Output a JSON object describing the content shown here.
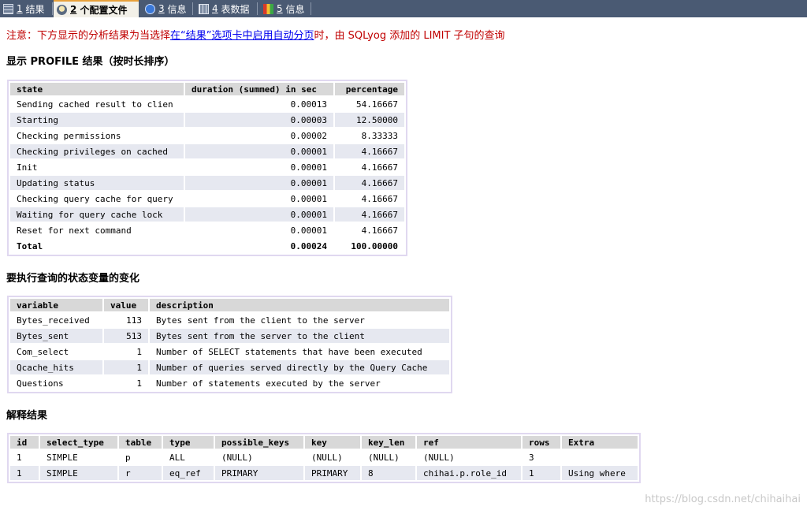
{
  "tabs": [
    {
      "num": "1",
      "label": "结果",
      "icon": "grid-icon"
    },
    {
      "num": "2",
      "label": "个配置文件",
      "icon": "profile-icon"
    },
    {
      "num": "3",
      "label": "信息",
      "icon": "info-icon"
    },
    {
      "num": "4",
      "label": "表数据",
      "icon": "table-icon"
    },
    {
      "num": "5",
      "label": "信息",
      "icon": "history-icon"
    }
  ],
  "notice": {
    "prefix": "注意：下方显示的分析结果为当选择",
    "link": "在“结果”选项卡中启用自动分页",
    "suffix": "时，由 SQLyog 添加的 LIMIT 子句的查询"
  },
  "profile": {
    "heading": "显示 PROFILE 结果（按时长排序）",
    "headers": [
      "state",
      "duration (summed) in sec",
      "percentage"
    ],
    "rows": [
      [
        "Sending cached result to clien",
        "0.00013",
        "54.16667"
      ],
      [
        "Starting",
        "0.00003",
        "12.50000"
      ],
      [
        "Checking permissions",
        "0.00002",
        "8.33333"
      ],
      [
        "Checking privileges on cached",
        "0.00001",
        "4.16667"
      ],
      [
        "Init",
        "0.00001",
        "4.16667"
      ],
      [
        "Updating status",
        "0.00001",
        "4.16667"
      ],
      [
        "Checking query cache for query",
        "0.00001",
        "4.16667"
      ],
      [
        "Waiting for query cache lock",
        "0.00001",
        "4.16667"
      ],
      [
        "Reset for next command",
        "0.00001",
        "4.16667"
      ],
      [
        "Total",
        "0.00024",
        "100.00000"
      ]
    ]
  },
  "status": {
    "heading": "要执行查询的状态变量的变化",
    "headers": [
      "variable",
      "value",
      "description"
    ],
    "rows": [
      [
        "Bytes_received",
        "113",
        "Bytes sent from the client to the server"
      ],
      [
        "Bytes_sent",
        "513",
        "Bytes sent from the server to the client"
      ],
      [
        "Com_select",
        "1",
        "Number of SELECT statements that have been executed"
      ],
      [
        "Qcache_hits",
        "1",
        "Number of queries served directly by the Query Cache"
      ],
      [
        "Questions",
        "1",
        "Number of statements executed by the server"
      ]
    ]
  },
  "explain": {
    "heading": "解释结果",
    "headers": [
      "id",
      "select_type",
      "table",
      "type",
      "possible_keys",
      "key",
      "key_len",
      "ref",
      "rows",
      "Extra"
    ],
    "rows": [
      [
        "1",
        "SIMPLE",
        "p",
        "ALL",
        "(NULL)",
        "(NULL)",
        "(NULL)",
        "(NULL)",
        "3",
        ""
      ],
      [
        "1",
        "SIMPLE",
        "r",
        "eq_ref",
        "PRIMARY",
        "PRIMARY",
        "8",
        "chihai.p.role_id",
        "1",
        "Using where"
      ]
    ]
  },
  "watermark": "https://blog.csdn.net/chihaihai",
  "colors": {
    "tabbar": "#4a5a73",
    "notice": "#c00000",
    "link": "#0000ee",
    "header_bg": "#d8d8d8",
    "alt_row": "#e6e8f0",
    "table_border": "#e0d8f0"
  }
}
